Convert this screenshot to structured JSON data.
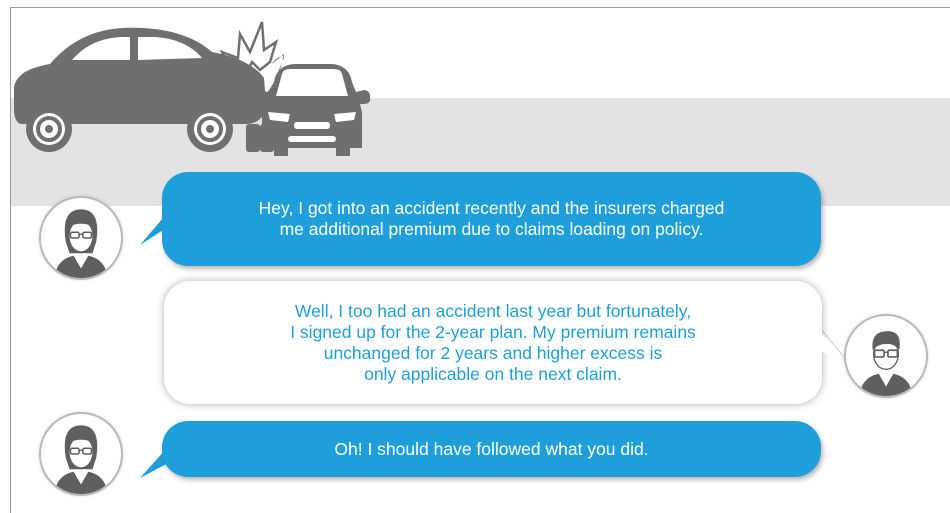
{
  "scene": {
    "illustration": "car-crash-icon",
    "colors": {
      "bubble_blue": "#1e9fdc",
      "car_gray": "#6f6f6f",
      "road_gray": "#e3e3e3"
    }
  },
  "conversation": [
    {
      "speaker": "woman",
      "style": "blue",
      "text": "Hey, I got into an accident recently and the insurers charged\nme additional premium due to claims loading on policy."
    },
    {
      "speaker": "man",
      "style": "white",
      "text": "Well, I too had an accident last year but fortunately,\nI signed up for the 2-year plan. My premium remains\nunchanged for 2 years and higher excess is\nonly applicable on the next claim."
    },
    {
      "speaker": "woman",
      "style": "blue",
      "text": "Oh! I should have followed what you did."
    }
  ]
}
